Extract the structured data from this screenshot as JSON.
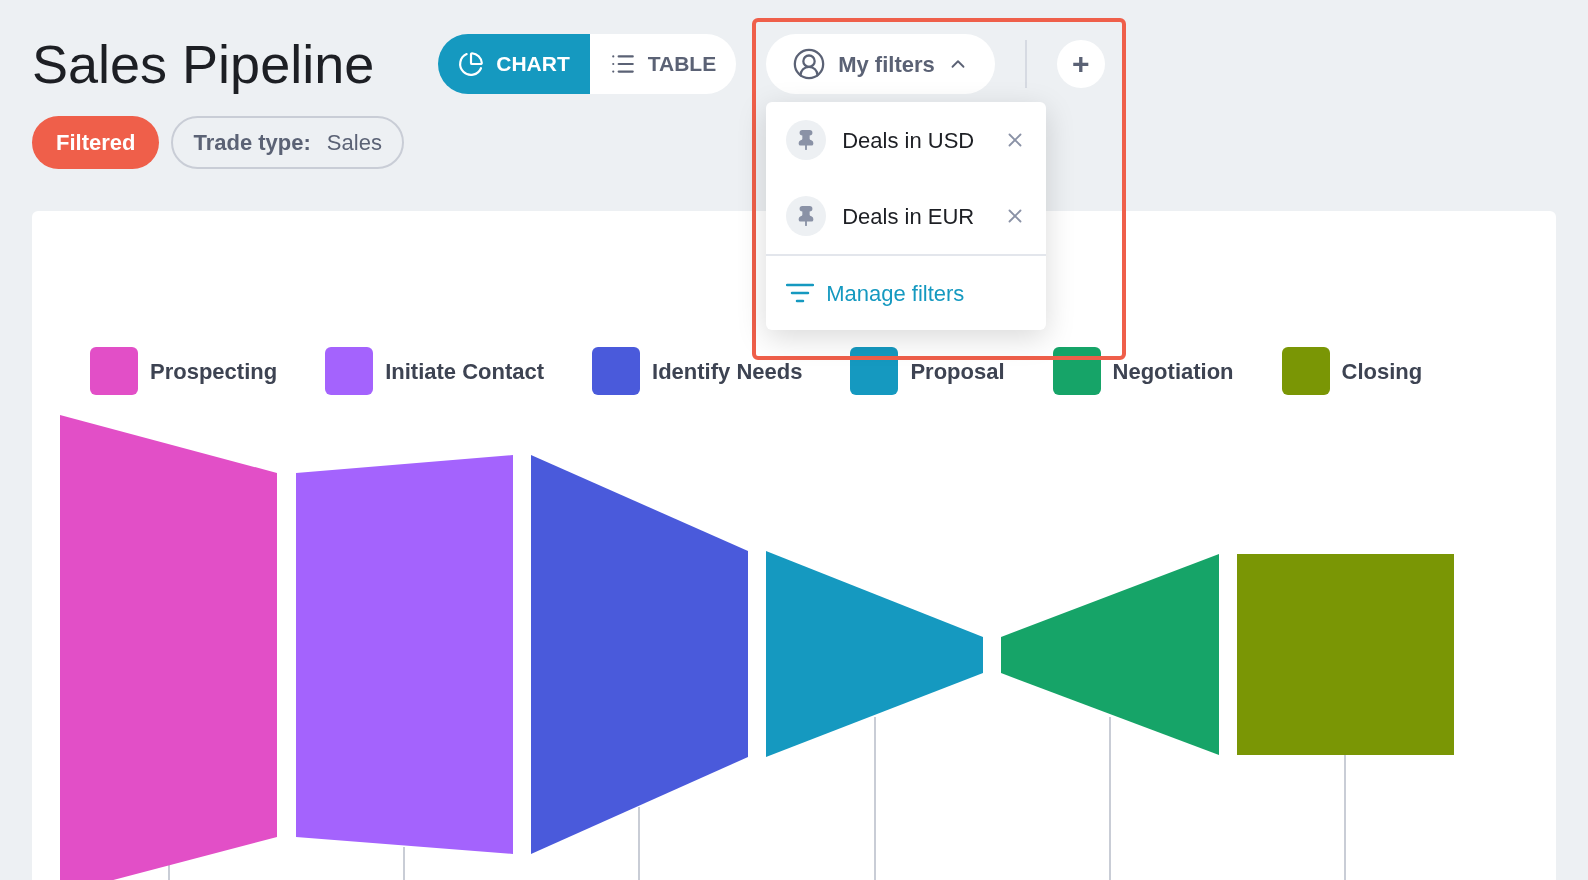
{
  "title": "Sales Pipeline",
  "view_toggle": [
    {
      "label": "CHART",
      "kind": "chart",
      "selected": true
    },
    {
      "label": "TABLE",
      "kind": "table",
      "selected": false
    }
  ],
  "my_filters": {
    "label": "My filters",
    "expanded": true,
    "items": [
      {
        "label": "Deals in USD"
      },
      {
        "label": "Deals in EUR"
      }
    ],
    "manage": "Manage filters"
  },
  "add_button": "+",
  "status_badge": "Filtered",
  "filter_chip": {
    "label": "Trade type:",
    "value": "Sales"
  },
  "legend": [
    {
      "label": "Prospecting",
      "color": "#e24fc7"
    },
    {
      "label": "Initiate Contact",
      "color": "#a463fd"
    },
    {
      "label": "Identify Needs",
      "color": "#4a5adb"
    },
    {
      "label": "Proposal",
      "color": "#1599c0"
    },
    {
      "label": "Negotiation",
      "color": "#16a468"
    },
    {
      "label": "Closing",
      "color": "#7a9605"
    }
  ]
}
